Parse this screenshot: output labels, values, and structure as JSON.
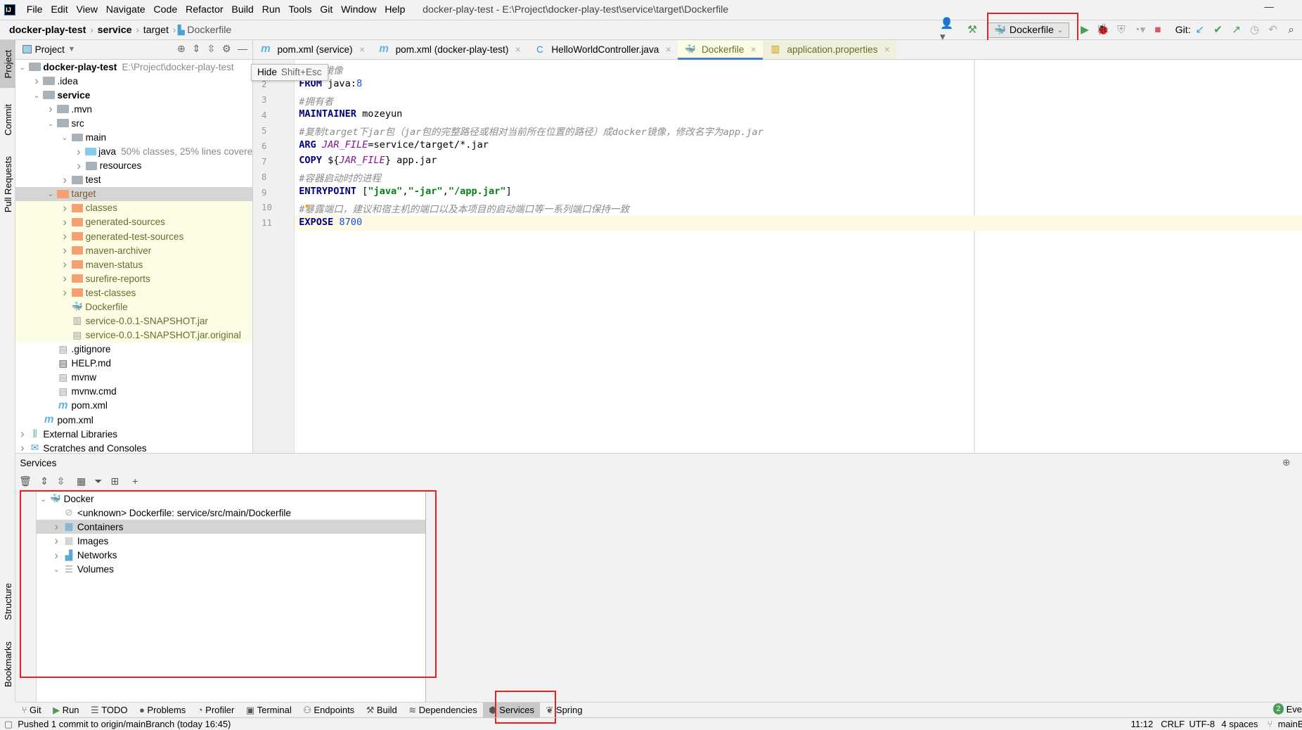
{
  "menubar": {
    "items": [
      "File",
      "Edit",
      "View",
      "Navigate",
      "Code",
      "Refactor",
      "Build",
      "Run",
      "Tools",
      "Git",
      "Window",
      "Help"
    ],
    "title": "docker-play-test - E:\\Project\\docker-play-test\\service\\target\\Dockerfile"
  },
  "breadcrumb": [
    "docker-play-test",
    "service",
    "target",
    "Dockerfile"
  ],
  "toolbar": {
    "run_config": "Dockerfile",
    "git_label": "Git:"
  },
  "stripe": {
    "project": "Project",
    "commit": "Commit",
    "pull_requests": "Pull Requests",
    "structure": "Structure",
    "bookmarks": "Bookmarks"
  },
  "project": {
    "title": "Project",
    "tree": [
      {
        "d": 0,
        "a": "v",
        "i": "module",
        "t": "docker-play-test",
        "b": true,
        "h": "E:\\Project\\docker-play-test"
      },
      {
        "d": 1,
        "a": ">",
        "i": "folder",
        "t": ".idea"
      },
      {
        "d": 1,
        "a": "v",
        "i": "module",
        "t": "service",
        "b": true
      },
      {
        "d": 2,
        "a": ">",
        "i": "folder",
        "t": ".mvn"
      },
      {
        "d": 2,
        "a": "v",
        "i": "folder",
        "t": "src"
      },
      {
        "d": 3,
        "a": "v",
        "i": "folder",
        "t": "main"
      },
      {
        "d": 4,
        "a": ">",
        "i": "src",
        "t": "java",
        "h": "50% classes, 25% lines covere"
      },
      {
        "d": 4,
        "a": ">",
        "i": "res",
        "t": "resources"
      },
      {
        "d": 3,
        "a": ">",
        "i": "folder",
        "t": "test"
      },
      {
        "d": 2,
        "a": "v",
        "i": "excl",
        "t": "target",
        "sel": true
      },
      {
        "d": 3,
        "a": ">",
        "i": "excl",
        "t": "classes",
        "y": true
      },
      {
        "d": 3,
        "a": ">",
        "i": "excl",
        "t": "generated-sources",
        "y": true
      },
      {
        "d": 3,
        "a": ">",
        "i": "excl",
        "t": "generated-test-sources",
        "y": true
      },
      {
        "d": 3,
        "a": ">",
        "i": "excl",
        "t": "maven-archiver",
        "y": true
      },
      {
        "d": 3,
        "a": ">",
        "i": "excl",
        "t": "maven-status",
        "y": true
      },
      {
        "d": 3,
        "a": ">",
        "i": "excl",
        "t": "surefire-reports",
        "y": true
      },
      {
        "d": 3,
        "a": ">",
        "i": "excl",
        "t": "test-classes",
        "y": true
      },
      {
        "d": 3,
        "a": "",
        "i": "docker",
        "t": "Dockerfile",
        "y": true
      },
      {
        "d": 3,
        "a": "",
        "i": "jar",
        "t": "service-0.0.1-SNAPSHOT.jar",
        "y": true
      },
      {
        "d": 3,
        "a": "",
        "i": "file",
        "t": "service-0.0.1-SNAPSHOT.jar.original",
        "y": true
      },
      {
        "d": 2,
        "a": "",
        "i": "file",
        "t": ".gitignore"
      },
      {
        "d": 2,
        "a": "",
        "i": "md",
        "t": "HELP.md"
      },
      {
        "d": 2,
        "a": "",
        "i": "file",
        "t": "mvnw"
      },
      {
        "d": 2,
        "a": "",
        "i": "file",
        "t": "mvnw.cmd"
      },
      {
        "d": 2,
        "a": "",
        "i": "maven",
        "t": "pom.xml"
      },
      {
        "d": 1,
        "a": "",
        "i": "maven",
        "t": "pom.xml"
      },
      {
        "d": 0,
        "a": ">",
        "i": "lib",
        "t": "External Libraries"
      },
      {
        "d": 0,
        "a": ">",
        "i": "scratch",
        "t": "Scratches and Consoles"
      }
    ]
  },
  "tabs": [
    {
      "label": "pom.xml (service)",
      "icon": "maven"
    },
    {
      "label": "pom.xml (docker-play-test)",
      "icon": "maven"
    },
    {
      "label": "HelloWorldController.java",
      "icon": "class"
    },
    {
      "label": "Dockerfile",
      "icon": "docker",
      "active": true
    },
    {
      "label": "application.properties",
      "icon": "props"
    }
  ],
  "tooltip": {
    "label": "Hide",
    "shortcut": "Shift+Esc"
  },
  "code": [
    [
      [
        "cm",
        "#基础镜像"
      ]
    ],
    [
      [
        "kw",
        "FROM "
      ],
      [
        "",
        "java:"
      ],
      [
        "num",
        "8"
      ]
    ],
    [
      [
        "cm",
        "#拥有者"
      ]
    ],
    [
      [
        "kw",
        "MAINTAINER "
      ],
      [
        "",
        "mozeyun"
      ]
    ],
    [
      [
        "cm",
        "#复制target下jar包（jar包的完整路径或相对当前所在位置的路径）成docker镜像，修改名字为app.jar"
      ]
    ],
    [
      [
        "kw",
        "ARG "
      ],
      [
        "var",
        "JAR_FILE"
      ],
      [
        "",
        "=service/target/*.jar"
      ]
    ],
    [
      [
        "kw",
        "COPY "
      ],
      [
        "",
        "${"
      ],
      [
        "var",
        "JAR_FILE"
      ],
      [
        "",
        "} app.jar"
      ]
    ],
    [
      [
        "cm",
        "#容器启动时的进程"
      ]
    ],
    [
      [
        "kw",
        "ENTRYPOINT "
      ],
      [
        "",
        "["
      ],
      [
        "str",
        "\"java\""
      ],
      [
        "",
        ","
      ],
      [
        "str",
        "\"-jar\""
      ],
      [
        "",
        ","
      ],
      [
        "str",
        "\"/app.jar\""
      ],
      [
        "",
        "]"
      ]
    ],
    [
      [
        "cm",
        "#暴露端口，建议和宿主机的端口以及本项目的启动端口等一系列端口保持一致"
      ]
    ],
    [
      [
        "kw",
        "EXPOSE "
      ],
      [
        "num",
        "8700"
      ]
    ]
  ],
  "services": {
    "title": "Services",
    "tree": [
      {
        "d": 0,
        "a": "v",
        "i": "docker",
        "t": "Docker"
      },
      {
        "d": 1,
        "a": "",
        "i": "unknown",
        "t": "<unknown> Dockerfile: service/src/main/Dockerfile"
      },
      {
        "d": 1,
        "a": ">",
        "i": "containers",
        "t": "Containers",
        "sel": true
      },
      {
        "d": 1,
        "a": ">",
        "i": "images",
        "t": "Images"
      },
      {
        "d": 1,
        "a": ">",
        "i": "networks",
        "t": "Networks"
      },
      {
        "d": 1,
        "a": "v",
        "i": "volumes",
        "t": "Volumes"
      }
    ]
  },
  "toolwindows": [
    {
      "label": "Git",
      "icon": "⑂"
    },
    {
      "label": "Run",
      "icon": "▶"
    },
    {
      "label": "TODO",
      "icon": "☰"
    },
    {
      "label": "Problems",
      "icon": "●"
    },
    {
      "label": "Profiler",
      "icon": "◔"
    },
    {
      "label": "Terminal",
      "icon": "▣"
    },
    {
      "label": "Endpoints",
      "icon": "⚇"
    },
    {
      "label": "Build",
      "icon": "⚒"
    },
    {
      "label": "Dependencies",
      "icon": "≋"
    },
    {
      "label": "Services",
      "icon": "⬢",
      "selected": true
    },
    {
      "label": "Spring",
      "icon": "❦"
    }
  ],
  "event_log": {
    "count": "2",
    "label": "Eve"
  },
  "status": {
    "message": "Pushed 1 commit to origin/mainBranch (today 16:45)",
    "position": "11:12",
    "line_sep": "CRLF",
    "encoding": "UTF-8",
    "indent": "4 spaces",
    "branch": "mainB"
  },
  "colors": {
    "highlight_red": "#f01d1d",
    "accent": "#4083c9",
    "excluded_folder": "#f4a070",
    "yellow_bg": "#fdfde6"
  }
}
